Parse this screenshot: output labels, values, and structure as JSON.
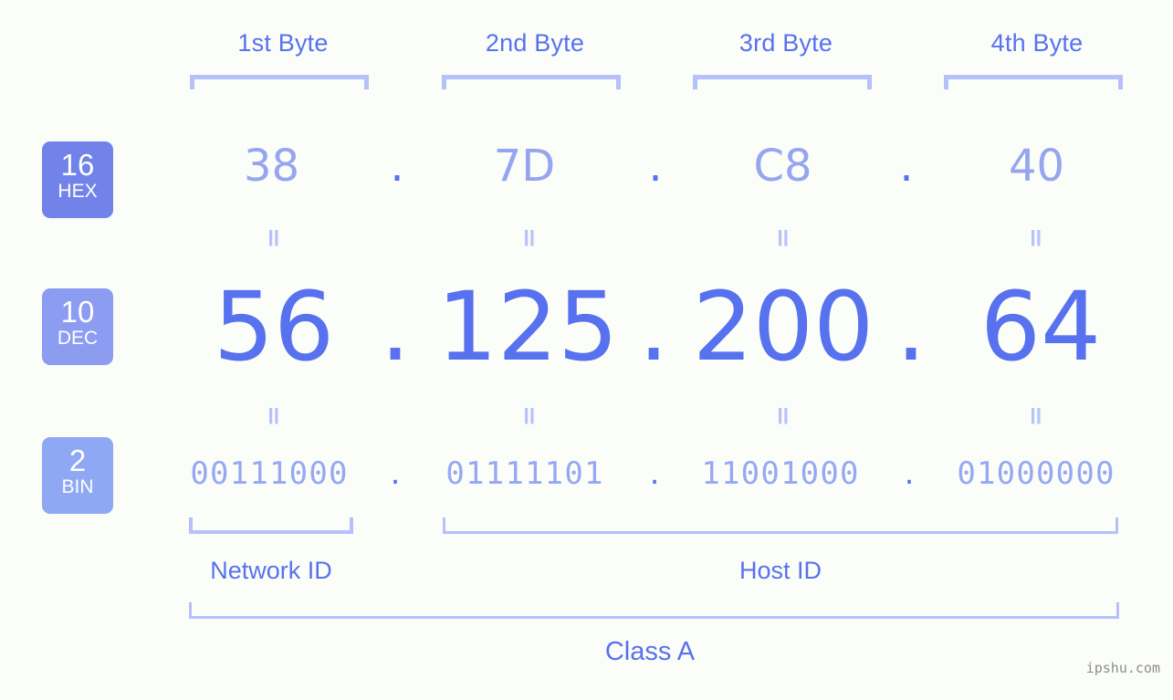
{
  "background_color": "#fbfdf8",
  "accent_color": "#5771ef",
  "accent_light_color": "#97a8f2",
  "bracket_color": "#b6c0fb",
  "header": {
    "bytes": [
      {
        "label": "1st Byte"
      },
      {
        "label": "2nd Byte"
      },
      {
        "label": "3rd Byte"
      },
      {
        "label": "4th Byte"
      }
    ]
  },
  "rows": {
    "hex": {
      "badge_number": "16",
      "badge_system": "HEX",
      "badge_color": "#7183e8",
      "values": [
        "38",
        "7D",
        "C8",
        "40"
      ],
      "separator": "."
    },
    "dec": {
      "badge_number": "10",
      "badge_system": "DEC",
      "badge_color": "#8c9cf0",
      "values": [
        "56",
        "125",
        "200",
        "64"
      ],
      "separator": "."
    },
    "bin": {
      "badge_number": "2",
      "badge_system": "BIN",
      "badge_color": "#8fa8f3",
      "values": [
        "00111000",
        "01111101",
        "11001000",
        "01000000"
      ],
      "separator": "."
    }
  },
  "equal_marks": {
    "glyph": "=",
    "count_per_row": 4
  },
  "footer": {
    "network_id_label": "Network ID",
    "host_id_label": "Host ID",
    "class_label": "Class A"
  },
  "watermark": {
    "text": "ipshu.com"
  }
}
